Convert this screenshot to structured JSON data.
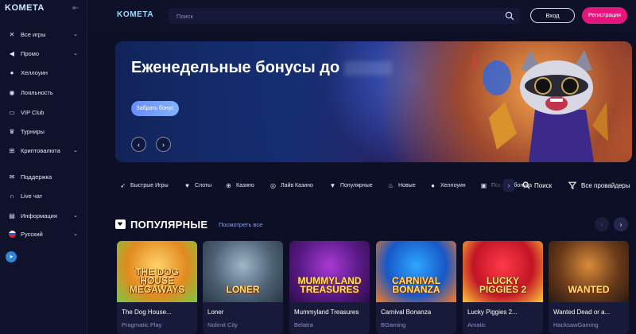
{
  "sidebar": {
    "logo": "KOMETA",
    "items": [
      {
        "label": "Все игры",
        "icon": "crossed-swords-icon",
        "chevron": true
      },
      {
        "label": "Промо",
        "icon": "megaphone-icon",
        "chevron": true
      },
      {
        "label": "Хеллоуин",
        "icon": "pumpkin-icon",
        "chevron": false
      },
      {
        "label": "Лояльность",
        "icon": "loyalty-icon",
        "chevron": false
      },
      {
        "label": "VIP Club",
        "icon": "vip-icon",
        "chevron": false
      },
      {
        "label": "Турниры",
        "icon": "trophy-icon",
        "chevron": false
      },
      {
        "label": "Криптовалюта",
        "icon": "crypto-icon",
        "chevron": true
      },
      {
        "label": "Поддержка",
        "icon": "support-icon",
        "chevron": false
      },
      {
        "label": "Live чат",
        "icon": "headset-icon",
        "chevron": false
      },
      {
        "label": "Информация",
        "icon": "info-icon",
        "chevron": true
      },
      {
        "label": "Русский",
        "icon": "russian-flag-icon",
        "chevron": true
      }
    ]
  },
  "topbar": {
    "logo": "KOMETA",
    "search_placeholder": "Поиск",
    "login_label": "Вход",
    "register_label": "Регистрация"
  },
  "banner": {
    "title": "Еженедельные бонусы до",
    "cta_label": "Забрать бонус"
  },
  "categories": [
    {
      "label": "Быстрые Игры",
      "icon": "rocket-icon"
    },
    {
      "label": "Слоты",
      "icon": "heart-icon"
    },
    {
      "label": "Казино",
      "icon": "poker-chip-icon"
    },
    {
      "label": "Лайв Казино",
      "icon": "live-icon"
    },
    {
      "label": "Популярные",
      "icon": "popular-icon"
    },
    {
      "label": "Новые",
      "icon": "flame-icon"
    },
    {
      "label": "Хеллоуин",
      "icon": "pumpkin-icon"
    },
    {
      "label": "Покупка бонуса",
      "icon": "gift-icon"
    }
  ],
  "cat_search_label": "Поиск",
  "cat_filter_label": "Все провайдеры",
  "popular": {
    "title": "ПОПУЛЯРНЫЕ",
    "see_all": "Посмотреть все",
    "games": [
      {
        "name": "The Dog House...",
        "provider": "Pragmatic Play",
        "art_text": "THE DOG HOUSE MEGAWAYS",
        "art_colors": [
          "#ffd36a",
          "#e28a1f",
          "#7ac943"
        ]
      },
      {
        "name": "Loner",
        "provider": "Nolimit City",
        "art_text": "LONER",
        "art_colors": [
          "#9fb7c8",
          "#4d6275",
          "#2a3744"
        ]
      },
      {
        "name": "Mummyland Treasures",
        "provider": "Belatra",
        "art_text": "MUMMYLAND TREASURES",
        "art_colors": [
          "#a93ad6",
          "#5a1a86",
          "#2d0d4a"
        ]
      },
      {
        "name": "Carnival Bonanza",
        "provider": "BGaming",
        "art_text": "CARNIVAL BONANZA",
        "art_colors": [
          "#2fa7ff",
          "#1858c8",
          "#ff7a1a"
        ]
      },
      {
        "name": "Lucky Piggies 2...",
        "provider": "Amatic",
        "art_text": "LUCKY PIGGIES 2",
        "art_colors": [
          "#ff3a4a",
          "#c21525",
          "#ffc83a"
        ]
      },
      {
        "name": "Wanted Dead or a...",
        "provider": "HacksawGaming",
        "art_text": "WANTED",
        "art_colors": [
          "#d98b3a",
          "#6a3a1a",
          "#2a1a10"
        ]
      }
    ]
  }
}
